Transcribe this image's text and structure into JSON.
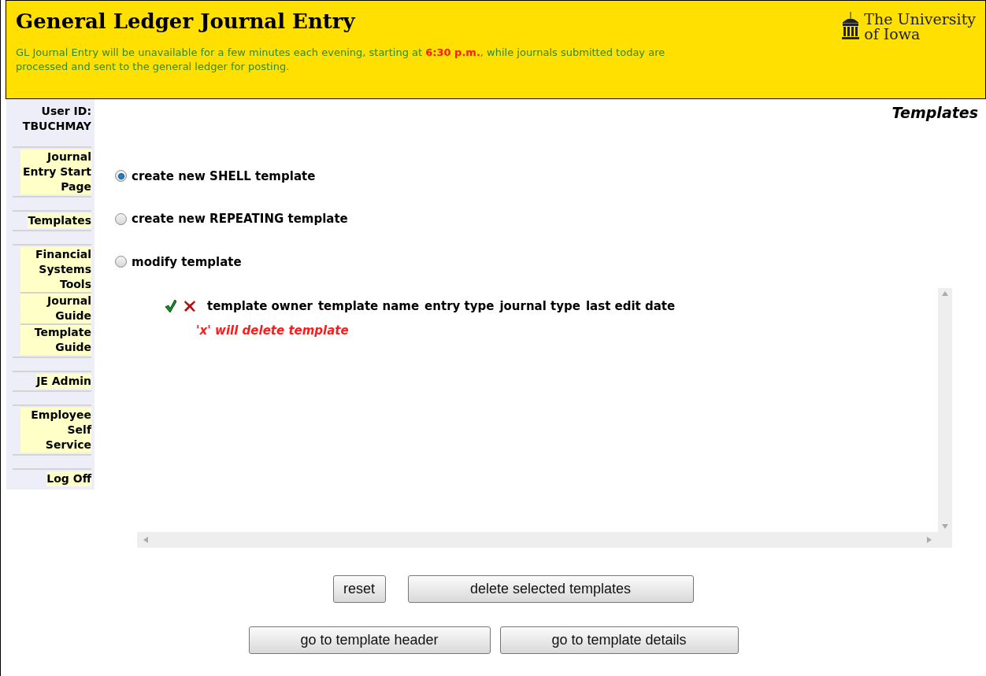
{
  "header": {
    "title": "General Ledger Journal Entry",
    "notice": "GL Journal Entry will be unavailable for a few minutes each evening, starting at **6:30 p.m.**, while journals submitted today are processed and sent to the general ledger for posting.",
    "logo_line_1": "The University",
    "logo_line_2": "of Iowa"
  },
  "sidebar": {
    "user_label": "User ID:",
    "user_id": "TBUCHMAY",
    "groups": [
      [
        {
          "label": "Journal Entry Start Page"
        }
      ],
      [
        {
          "label": "Templates"
        }
      ],
      [
        {
          "label": "Financial Systems Tools"
        },
        {
          "label": "Journal Guide"
        },
        {
          "label": "Template Guide"
        }
      ],
      [
        {
          "label": "JE Admin"
        }
      ],
      [
        {
          "label": "Employee Self Service"
        }
      ],
      [
        {
          "label": "Log Off"
        }
      ]
    ]
  },
  "page_title": "Templates",
  "options": [
    {
      "label": "create new SHELL template",
      "selected": true
    },
    {
      "label": "create new REPEATING template",
      "selected": false
    },
    {
      "label": "modify template",
      "selected": false
    }
  ],
  "template_list": {
    "columns": [
      "template owner",
      "template name",
      "entry type",
      "journal type",
      "last edit date"
    ],
    "note": "'x' will delete template"
  },
  "buttons": [
    [
      "reset",
      "delete selected templates"
    ],
    [
      "go to template header",
      "go to template details"
    ]
  ]
}
